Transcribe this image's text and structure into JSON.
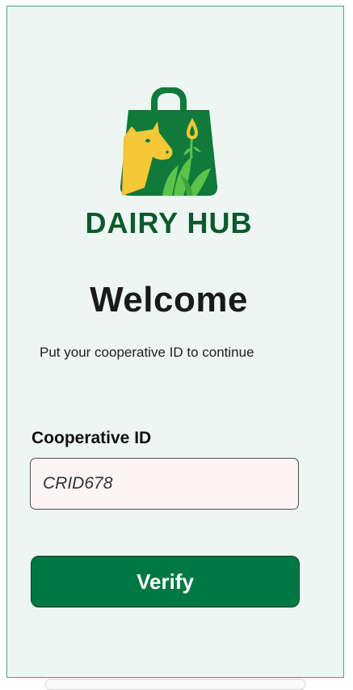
{
  "brand": {
    "name": "DAIRY HUB",
    "colors": {
      "bag": "#0f7a3a",
      "brand_text": "#0c5a2d",
      "cow": "#f6c736",
      "leaves": "#5cc34a"
    }
  },
  "welcome": {
    "title": "Welcome",
    "subtitle": "Put your cooperative ID to continue"
  },
  "form": {
    "cooperative_id_label": "Cooperative ID",
    "cooperative_id_value": "CRID678",
    "verify_label": "Verify"
  },
  "theme": {
    "background": "#edf6f2",
    "border": "#3fa98c",
    "input_background": "#fdf5f5",
    "button": "#007844"
  }
}
